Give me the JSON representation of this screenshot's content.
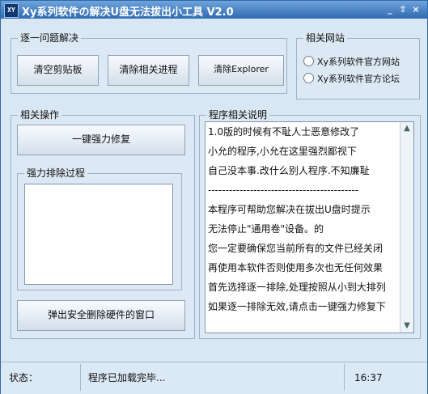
{
  "window": {
    "app_icon_text": "XY",
    "title": "Xy系列软件の解决U盘无法拔出小工具 V2.0",
    "controls": [
      "_",
      "⇧",
      "×"
    ]
  },
  "groups": {
    "step": {
      "title": "逐一问题解决",
      "buttons": [
        "清空剪贴板",
        "清除相关进程",
        "清除Explorer"
      ]
    },
    "sites": {
      "title": "相关网站",
      "options": [
        "Xy系列软件官方网站",
        "Xy系列软件官方论坛"
      ]
    },
    "ops": {
      "title": "相关操作",
      "force_fix": "一键强力修复",
      "process_title": "强力排除过程",
      "eject": "弹出安全删除硬件的窗口"
    },
    "desc": {
      "title": "程序相关说明",
      "lines": [
        "1.0版的时候有不耻人士恶意修改了",
        "小允的程序,小允在这里强烈鄙视下",
        "自己没本事.改什么别人程序.不知廉耻",
        "-------------------------------------------",
        "本程序可帮助您解决在拔出U盘时提示",
        "无法停止\"通用卷\"设备。的",
        "您一定要确保您当前所有的文件已经关闭",
        "再使用本软件否则使用多次也无任何效果",
        "首先选择逐一排除,处理按照从小到大排列",
        "如果逐一排除无效,请点击一键强力修复下"
      ]
    }
  },
  "status": {
    "label": "状态：",
    "message": "程序已加载完毕...",
    "time": "16:37"
  }
}
